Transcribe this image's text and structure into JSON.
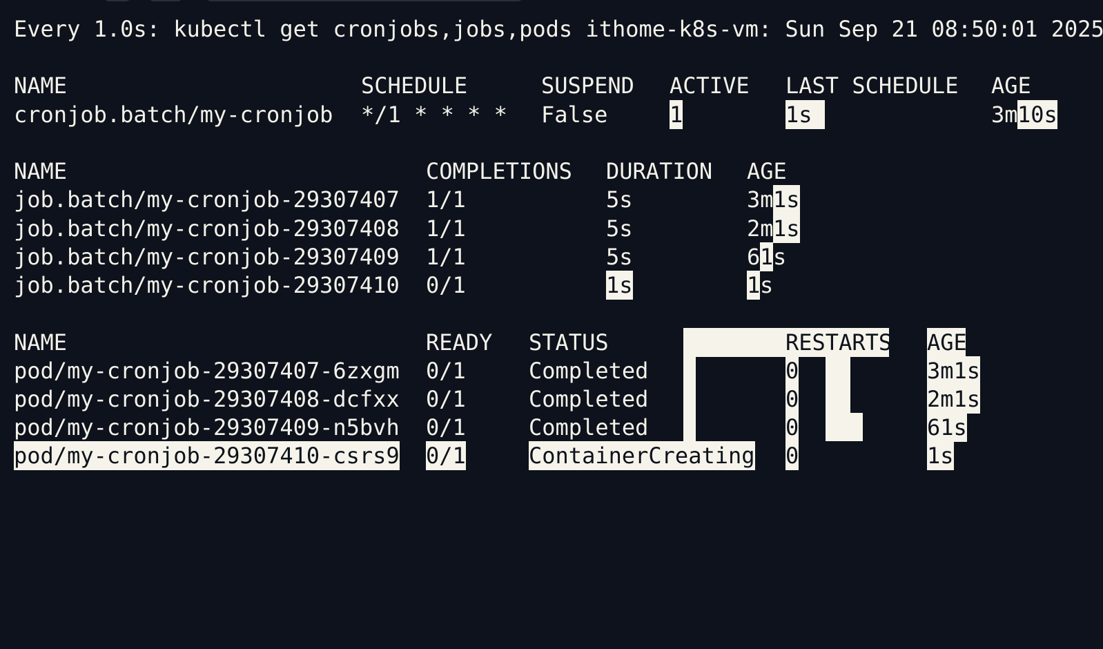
{
  "header": {
    "command_line": "Every 1.0s: kubectl get cronjobs,jobs,pods ithome-k8s-vm: Sun Sep 21 08:50:01 2025"
  },
  "cronjobs": {
    "headers": [
      "NAME",
      "SCHEDULE",
      "SUSPEND",
      "ACTIVE",
      "LAST SCHEDULE",
      "AGE"
    ],
    "row": {
      "name": "cronjob.batch/my-cronjob",
      "schedule": "*/1 * * * *",
      "suspend": "False",
      "active": "1",
      "last_schedule": "1s",
      "age_prefix": "3m",
      "age_suffix": "10s"
    }
  },
  "jobs": {
    "headers": [
      "NAME",
      "COMPLETIONS",
      "DURATION",
      "AGE"
    ],
    "rows": [
      {
        "name": "job.batch/my-cronjob-29307407",
        "completions": "1/1",
        "duration": "5s",
        "age_a": "3m",
        "age_b": "1s",
        "age_c": ""
      },
      {
        "name": "job.batch/my-cronjob-29307408",
        "completions": "1/1",
        "duration": "5s",
        "age_a": "2m",
        "age_b": "1s",
        "age_c": ""
      },
      {
        "name": "job.batch/my-cronjob-29307409",
        "completions": "1/1",
        "duration": "5s",
        "age_a": "6",
        "age_b": "1",
        "age_c": "s"
      },
      {
        "name": "job.batch/my-cronjob-29307410",
        "completions": "0/1",
        "duration": "1s",
        "age_a": "",
        "age_b": "1",
        "age_c": "s"
      }
    ]
  },
  "pods": {
    "headers": [
      "NAME",
      "READY",
      "STATUS",
      "RESTARTS",
      "AGE"
    ],
    "rows": [
      {
        "name": "pod/my-cronjob-29307407-6zxgm",
        "ready": "0/1",
        "status": "Completed",
        "restarts": "0",
        "age": "3m1s"
      },
      {
        "name": "pod/my-cronjob-29307408-dcfxx",
        "ready": "0/1",
        "status": "Completed",
        "restarts": "0",
        "age": "2m1s"
      },
      {
        "name": "pod/my-cronjob-29307409-n5bvh",
        "ready": "0/1",
        "status": "Completed",
        "restarts": "0",
        "age": "61s"
      },
      {
        "name": "pod/my-cronjob-29307410-csrs9",
        "ready": "0/1",
        "status": "ContainerCreating",
        "restarts": "0",
        "age": "1s"
      }
    ]
  },
  "colors": {
    "background": "#0d121c",
    "foreground": "#f3f2ea",
    "highlight": "#f6f4ea"
  }
}
